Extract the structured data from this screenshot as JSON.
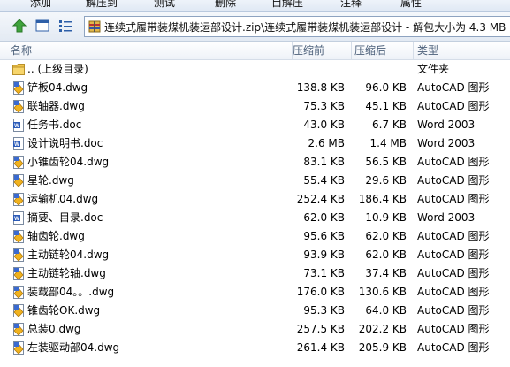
{
  "menu": [
    "添加",
    "解压到",
    "测试",
    "删除",
    "自解压",
    "注释",
    "属性"
  ],
  "address": {
    "path": "连续式履带装煤机装运部设计.zip\\连续式履带装煤机装运部设计 - 解包大小为 4.3 MB"
  },
  "columns": {
    "name": "名称",
    "size": "压缩前",
    "packed": "压缩后",
    "type": "类型"
  },
  "files": [
    {
      "name": ".. (上级目录)",
      "size": "",
      "packed": "",
      "type": "文件夹",
      "icon": "folder-icon"
    },
    {
      "name": "铲板04.dwg",
      "size": "138.8 KB",
      "packed": "96.0 KB",
      "type": "AutoCAD 图形",
      "icon": "dwg-file-icon"
    },
    {
      "name": "联轴器.dwg",
      "size": "75.3 KB",
      "packed": "45.1 KB",
      "type": "AutoCAD 图形",
      "icon": "dwg-file-icon"
    },
    {
      "name": "任务书.doc",
      "size": "43.0 KB",
      "packed": "6.7 KB",
      "type": "Word 2003",
      "icon": "word-file-icon"
    },
    {
      "name": "设计说明书.doc",
      "size": "2.6 MB",
      "packed": "1.4 MB",
      "type": "Word 2003",
      "icon": "word-file-icon"
    },
    {
      "name": "小锥齿轮04.dwg",
      "size": "83.1 KB",
      "packed": "56.5 KB",
      "type": "AutoCAD 图形",
      "icon": "dwg-file-icon"
    },
    {
      "name": "星轮.dwg",
      "size": "55.4 KB",
      "packed": "29.6 KB",
      "type": "AutoCAD 图形",
      "icon": "dwg-file-icon"
    },
    {
      "name": "运输机04.dwg",
      "size": "252.4 KB",
      "packed": "186.4 KB",
      "type": "AutoCAD 图形",
      "icon": "dwg-file-icon"
    },
    {
      "name": "摘要、目录.doc",
      "size": "62.0 KB",
      "packed": "10.9 KB",
      "type": "Word 2003",
      "icon": "word-file-icon"
    },
    {
      "name": "轴齿轮.dwg",
      "size": "95.6 KB",
      "packed": "62.0 KB",
      "type": "AutoCAD 图形",
      "icon": "dwg-file-icon"
    },
    {
      "name": "主动链轮04.dwg",
      "size": "93.9 KB",
      "packed": "62.0 KB",
      "type": "AutoCAD 图形",
      "icon": "dwg-file-icon"
    },
    {
      "name": "主动链轮轴.dwg",
      "size": "73.1 KB",
      "packed": "37.4 KB",
      "type": "AutoCAD 图形",
      "icon": "dwg-file-icon"
    },
    {
      "name": "装载部04。。.dwg",
      "size": "176.0 KB",
      "packed": "130.6 KB",
      "type": "AutoCAD 图形",
      "icon": "dwg-file-icon"
    },
    {
      "name": "锥齿轮OK.dwg",
      "size": "95.3 KB",
      "packed": "64.0 KB",
      "type": "AutoCAD 图形",
      "icon": "dwg-file-icon"
    },
    {
      "name": "总装0.dwg",
      "size": "257.5 KB",
      "packed": "202.2 KB",
      "type": "AutoCAD 图形",
      "icon": "dwg-file-icon"
    },
    {
      "name": "左装驱动部04.dwg",
      "size": "261.4 KB",
      "packed": "205.9 KB",
      "type": "AutoCAD 图形",
      "icon": "dwg-file-icon"
    }
  ]
}
